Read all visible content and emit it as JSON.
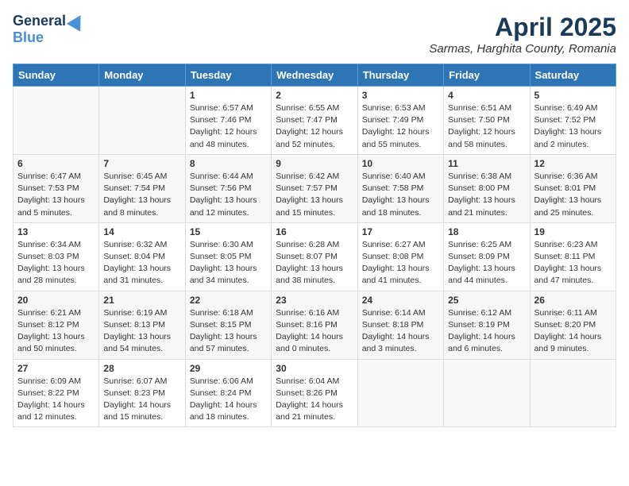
{
  "header": {
    "logo_general": "General",
    "logo_blue": "Blue",
    "title": "April 2025",
    "subtitle": "Sarmas, Harghita County, Romania"
  },
  "weekdays": [
    "Sunday",
    "Monday",
    "Tuesday",
    "Wednesday",
    "Thursday",
    "Friday",
    "Saturday"
  ],
  "weeks": [
    [
      {
        "day": "",
        "sunrise": "",
        "sunset": "",
        "daylight": ""
      },
      {
        "day": "",
        "sunrise": "",
        "sunset": "",
        "daylight": ""
      },
      {
        "day": "1",
        "sunrise": "Sunrise: 6:57 AM",
        "sunset": "Sunset: 7:46 PM",
        "daylight": "Daylight: 12 hours and 48 minutes."
      },
      {
        "day": "2",
        "sunrise": "Sunrise: 6:55 AM",
        "sunset": "Sunset: 7:47 PM",
        "daylight": "Daylight: 12 hours and 52 minutes."
      },
      {
        "day": "3",
        "sunrise": "Sunrise: 6:53 AM",
        "sunset": "Sunset: 7:49 PM",
        "daylight": "Daylight: 12 hours and 55 minutes."
      },
      {
        "day": "4",
        "sunrise": "Sunrise: 6:51 AM",
        "sunset": "Sunset: 7:50 PM",
        "daylight": "Daylight: 12 hours and 58 minutes."
      },
      {
        "day": "5",
        "sunrise": "Sunrise: 6:49 AM",
        "sunset": "Sunset: 7:52 PM",
        "daylight": "Daylight: 13 hours and 2 minutes."
      }
    ],
    [
      {
        "day": "6",
        "sunrise": "Sunrise: 6:47 AM",
        "sunset": "Sunset: 7:53 PM",
        "daylight": "Daylight: 13 hours and 5 minutes."
      },
      {
        "day": "7",
        "sunrise": "Sunrise: 6:45 AM",
        "sunset": "Sunset: 7:54 PM",
        "daylight": "Daylight: 13 hours and 8 minutes."
      },
      {
        "day": "8",
        "sunrise": "Sunrise: 6:44 AM",
        "sunset": "Sunset: 7:56 PM",
        "daylight": "Daylight: 13 hours and 12 minutes."
      },
      {
        "day": "9",
        "sunrise": "Sunrise: 6:42 AM",
        "sunset": "Sunset: 7:57 PM",
        "daylight": "Daylight: 13 hours and 15 minutes."
      },
      {
        "day": "10",
        "sunrise": "Sunrise: 6:40 AM",
        "sunset": "Sunset: 7:58 PM",
        "daylight": "Daylight: 13 hours and 18 minutes."
      },
      {
        "day": "11",
        "sunrise": "Sunrise: 6:38 AM",
        "sunset": "Sunset: 8:00 PM",
        "daylight": "Daylight: 13 hours and 21 minutes."
      },
      {
        "day": "12",
        "sunrise": "Sunrise: 6:36 AM",
        "sunset": "Sunset: 8:01 PM",
        "daylight": "Daylight: 13 hours and 25 minutes."
      }
    ],
    [
      {
        "day": "13",
        "sunrise": "Sunrise: 6:34 AM",
        "sunset": "Sunset: 8:03 PM",
        "daylight": "Daylight: 13 hours and 28 minutes."
      },
      {
        "day": "14",
        "sunrise": "Sunrise: 6:32 AM",
        "sunset": "Sunset: 8:04 PM",
        "daylight": "Daylight: 13 hours and 31 minutes."
      },
      {
        "day": "15",
        "sunrise": "Sunrise: 6:30 AM",
        "sunset": "Sunset: 8:05 PM",
        "daylight": "Daylight: 13 hours and 34 minutes."
      },
      {
        "day": "16",
        "sunrise": "Sunrise: 6:28 AM",
        "sunset": "Sunset: 8:07 PM",
        "daylight": "Daylight: 13 hours and 38 minutes."
      },
      {
        "day": "17",
        "sunrise": "Sunrise: 6:27 AM",
        "sunset": "Sunset: 8:08 PM",
        "daylight": "Daylight: 13 hours and 41 minutes."
      },
      {
        "day": "18",
        "sunrise": "Sunrise: 6:25 AM",
        "sunset": "Sunset: 8:09 PM",
        "daylight": "Daylight: 13 hours and 44 minutes."
      },
      {
        "day": "19",
        "sunrise": "Sunrise: 6:23 AM",
        "sunset": "Sunset: 8:11 PM",
        "daylight": "Daylight: 13 hours and 47 minutes."
      }
    ],
    [
      {
        "day": "20",
        "sunrise": "Sunrise: 6:21 AM",
        "sunset": "Sunset: 8:12 PM",
        "daylight": "Daylight: 13 hours and 50 minutes."
      },
      {
        "day": "21",
        "sunrise": "Sunrise: 6:19 AM",
        "sunset": "Sunset: 8:13 PM",
        "daylight": "Daylight: 13 hours and 54 minutes."
      },
      {
        "day": "22",
        "sunrise": "Sunrise: 6:18 AM",
        "sunset": "Sunset: 8:15 PM",
        "daylight": "Daylight: 13 hours and 57 minutes."
      },
      {
        "day": "23",
        "sunrise": "Sunrise: 6:16 AM",
        "sunset": "Sunset: 8:16 PM",
        "daylight": "Daylight: 14 hours and 0 minutes."
      },
      {
        "day": "24",
        "sunrise": "Sunrise: 6:14 AM",
        "sunset": "Sunset: 8:18 PM",
        "daylight": "Daylight: 14 hours and 3 minutes."
      },
      {
        "day": "25",
        "sunrise": "Sunrise: 6:12 AM",
        "sunset": "Sunset: 8:19 PM",
        "daylight": "Daylight: 14 hours and 6 minutes."
      },
      {
        "day": "26",
        "sunrise": "Sunrise: 6:11 AM",
        "sunset": "Sunset: 8:20 PM",
        "daylight": "Daylight: 14 hours and 9 minutes."
      }
    ],
    [
      {
        "day": "27",
        "sunrise": "Sunrise: 6:09 AM",
        "sunset": "Sunset: 8:22 PM",
        "daylight": "Daylight: 14 hours and 12 minutes."
      },
      {
        "day": "28",
        "sunrise": "Sunrise: 6:07 AM",
        "sunset": "Sunset: 8:23 PM",
        "daylight": "Daylight: 14 hours and 15 minutes."
      },
      {
        "day": "29",
        "sunrise": "Sunrise: 6:06 AM",
        "sunset": "Sunset: 8:24 PM",
        "daylight": "Daylight: 14 hours and 18 minutes."
      },
      {
        "day": "30",
        "sunrise": "Sunrise: 6:04 AM",
        "sunset": "Sunset: 8:26 PM",
        "daylight": "Daylight: 14 hours and 21 minutes."
      },
      {
        "day": "",
        "sunrise": "",
        "sunset": "",
        "daylight": ""
      },
      {
        "day": "",
        "sunrise": "",
        "sunset": "",
        "daylight": ""
      },
      {
        "day": "",
        "sunrise": "",
        "sunset": "",
        "daylight": ""
      }
    ]
  ]
}
